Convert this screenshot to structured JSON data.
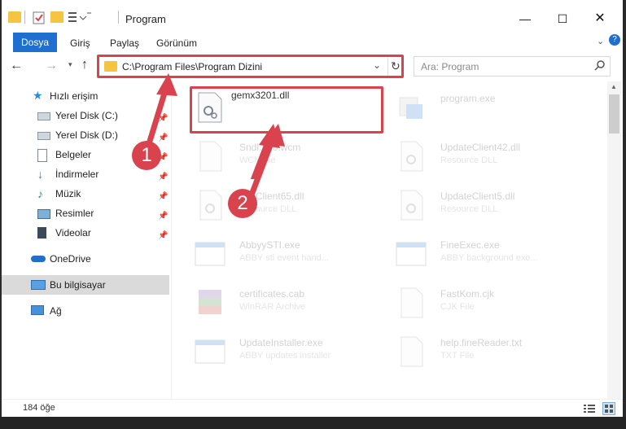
{
  "window": {
    "title": "Program"
  },
  "ribbon": {
    "tabs": [
      "Dosya",
      "Giriş",
      "Paylaş",
      "Görünüm"
    ]
  },
  "address": {
    "path": "C:\\Program Files\\Program Dizini"
  },
  "search": {
    "placeholder": "Ara: Program"
  },
  "sidebar": {
    "items": [
      {
        "label": "Hızlı erişim",
        "icon": "star-icon"
      },
      {
        "label": "Yerel Disk (C:)",
        "icon": "drive-icon",
        "pinned": true
      },
      {
        "label": "Yerel Disk (D:)",
        "icon": "drive-icon",
        "pinned": true
      },
      {
        "label": "Belgeler",
        "icon": "document-icon",
        "pinned": true
      },
      {
        "label": "İndirmeler",
        "icon": "download-icon",
        "pinned": true
      },
      {
        "label": "Müzik",
        "icon": "music-icon",
        "pinned": true
      },
      {
        "label": "Resimler",
        "icon": "pictures-icon",
        "pinned": true
      },
      {
        "label": "Videolar",
        "icon": "video-icon",
        "pinned": true
      },
      {
        "label": "OneDrive",
        "icon": "cloud-icon"
      },
      {
        "label": "Bu bilgisayar",
        "icon": "computer-icon",
        "selected": true
      },
      {
        "label": "Ağ",
        "icon": "network-icon"
      }
    ]
  },
  "files": [
    {
      "name": "gemx3201.dll",
      "sub": "",
      "icon": "dll-icon",
      "highlight": true
    },
    {
      "name": "program.exe",
      "sub": "",
      "icon": "exe-icon"
    },
    {
      "name": "Sndl...10.wcm",
      "sub": "WCM file",
      "icon": "file-icon"
    },
    {
      "name": "UpdateClient42.dll",
      "sub": "Resource DLL",
      "icon": "dll-icon"
    },
    {
      "name": "...teClient65.dll",
      "sub": "Resource DLL",
      "icon": "dll-icon"
    },
    {
      "name": "UpdateClient5.dll",
      "sub": "Resource DLL",
      "icon": "dll-icon"
    },
    {
      "name": "AbbyySTI.exe",
      "sub": "ABBY sti event hand...",
      "icon": "window-icon"
    },
    {
      "name": "FineExec.exe",
      "sub": "ABBY background exe...",
      "icon": "window-icon"
    },
    {
      "name": "certificates.cab",
      "sub": "WinRAR Archive",
      "icon": "archive-icon"
    },
    {
      "name": "FastKom.cjk",
      "sub": "CJK File",
      "icon": "file-icon"
    },
    {
      "name": "UpdateInstaller.exe",
      "sub": "ABBY updates installer",
      "icon": "window-icon"
    },
    {
      "name": "help.fineReader.txt",
      "sub": "TXT File",
      "icon": "file-icon"
    }
  ],
  "status": {
    "count": "184 öğe"
  },
  "annotations": {
    "step1": "1",
    "step2": "2"
  },
  "colors": {
    "accent": "#1e6fcf",
    "highlight": "#d9434e",
    "selected": "#dadada"
  }
}
